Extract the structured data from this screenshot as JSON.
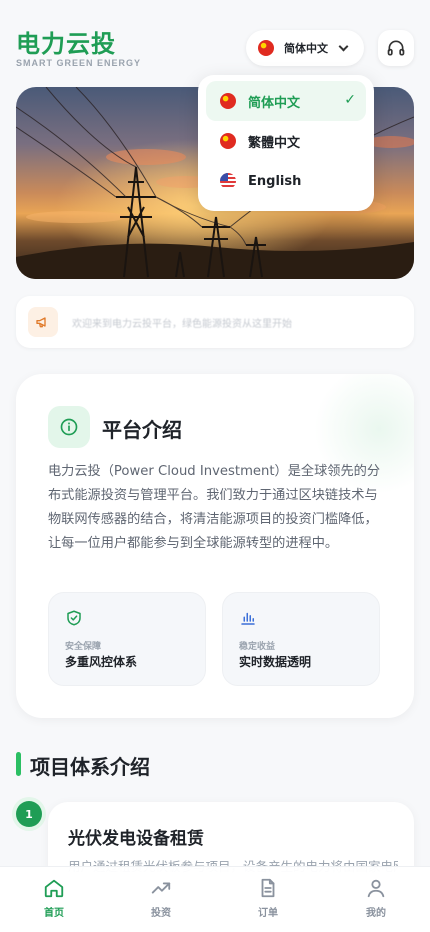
{
  "header": {
    "title": "电力云投",
    "subtitle": "SMART GREEN ENERGY",
    "language_button": {
      "label": "简体中文",
      "flag": "cn-flag-icon"
    },
    "support_icon": "headset-icon"
  },
  "language_menu": {
    "items": [
      {
        "label": "简体中文",
        "flag": "cn-flag-icon",
        "selected": true,
        "check": "✓"
      },
      {
        "label": "繁體中文",
        "flag": "cn-flag-icon",
        "selected": false
      },
      {
        "label": "English",
        "flag": "us-flag-icon",
        "selected": false
      }
    ]
  },
  "notice": {
    "icon": "megaphone-icon",
    "text": "欢迎来到电力云投平台，绿色能源投资从这里开始"
  },
  "platform": {
    "icon": "info-icon",
    "title": "平台介绍",
    "description": "电力云投（Power Cloud Investment）是全球领先的分布式能源投资与管理平台。我们致力于通过区块链技术与物联网传感器的结合，将清洁能源项目的投资门槛降低，让每一位用户都能参与到全球能源转型的进程中。",
    "features": [
      {
        "icon": "shield-check-icon",
        "label": "安全保障",
        "value": "多重风控体系"
      },
      {
        "icon": "bar-chart-icon",
        "label": "稳定收益",
        "value": "实时数据透明"
      }
    ]
  },
  "section": {
    "title": "项目体系介绍"
  },
  "projects": [
    {
      "number": "1",
      "title": "光伏发电设备租赁",
      "description": "用户通过租赁光伏板参与项目，设备产生的电力将由国家电网"
    }
  ],
  "bottom_nav": {
    "items": [
      {
        "label": "首页",
        "icon": "home-icon",
        "active": true
      },
      {
        "label": "投资",
        "icon": "trending-up-icon",
        "active": false
      },
      {
        "label": "订单",
        "icon": "document-icon",
        "active": false
      },
      {
        "label": "我的",
        "icon": "user-icon",
        "active": false
      }
    ]
  },
  "colors": {
    "brand_green": "#1f9d55",
    "accent_green": "#2bbf63",
    "background": "#f7f8fa"
  }
}
